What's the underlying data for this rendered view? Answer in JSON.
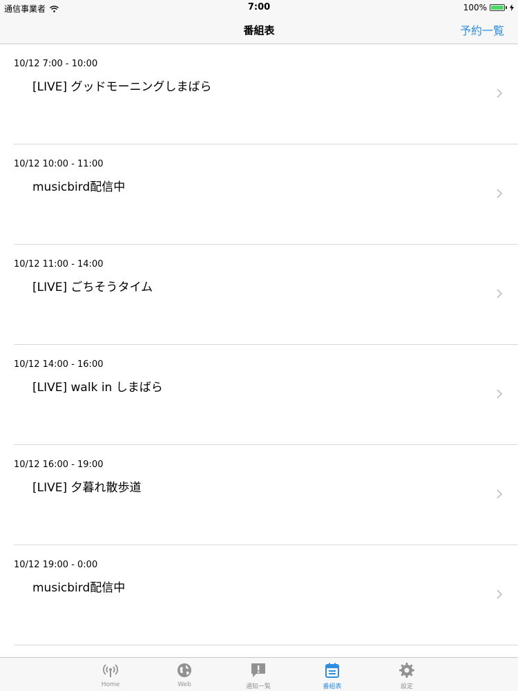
{
  "status_bar": {
    "carrier": "通信事業者",
    "time": "7:00",
    "battery": "100%"
  },
  "nav": {
    "title": "番組表",
    "right_button": "予約一覧"
  },
  "programs": [
    {
      "time": "10/12 7:00 - 10:00",
      "title": "[LIVE] グッドモーニングしまばら"
    },
    {
      "time": "10/12 10:00 - 11:00",
      "title": "musicbird配信中"
    },
    {
      "time": "10/12 11:00 - 14:00",
      "title": "[LIVE] ごちそうタイム"
    },
    {
      "time": "10/12 14:00 - 16:00",
      "title": "[LIVE] walk in しまばら"
    },
    {
      "time": "10/12 16:00 - 19:00",
      "title": "[LIVE] 夕暮れ散歩道"
    },
    {
      "time": "10/12 19:00 - 0:00",
      "title": "musicbird配信中"
    }
  ],
  "tabs": [
    {
      "label": "Home",
      "icon": "broadcast-icon",
      "active": false
    },
    {
      "label": "Web",
      "icon": "globe-icon",
      "active": false
    },
    {
      "label": "通知一覧",
      "icon": "notification-icon",
      "active": false
    },
    {
      "label": "番組表",
      "icon": "calendar-icon",
      "active": true
    },
    {
      "label": "設定",
      "icon": "gear-icon",
      "active": false
    }
  ],
  "colors": {
    "accent": "#2f8de0",
    "inactive": "#929292",
    "battery": "#4cd964"
  }
}
